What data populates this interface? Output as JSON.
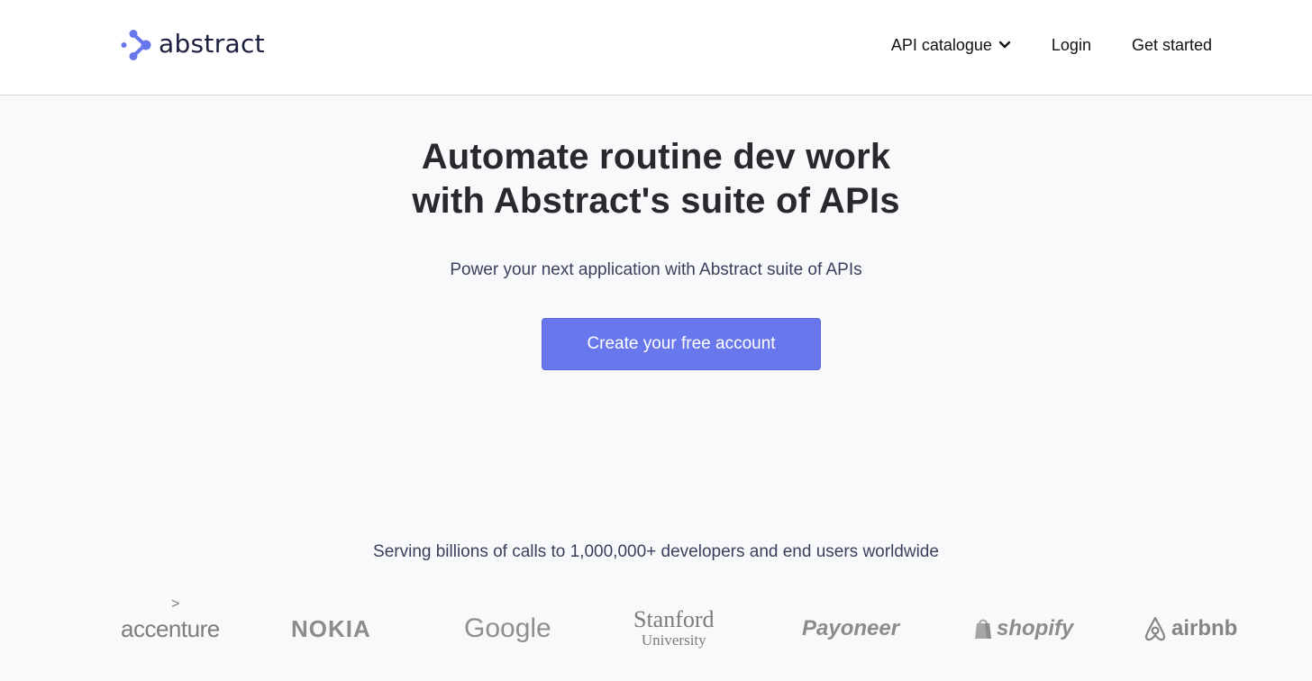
{
  "header": {
    "logo_text": "abstract",
    "nav": [
      {
        "label": "API catalogue",
        "has_dropdown": true
      },
      {
        "label": "Login"
      },
      {
        "label": "Get started"
      }
    ]
  },
  "hero": {
    "title_line1": "Automate routine dev work",
    "title_line2": "with Abstract's suite of APIs",
    "subtitle": "Power your next application with Abstract suite of APIs",
    "cta_label": "Create your free account"
  },
  "trust": {
    "text": "Serving billions of calls to 1,000,000+ developers and end users worldwide",
    "brands": [
      {
        "name": "accenture"
      },
      {
        "name": "NOKIA"
      },
      {
        "name": "Google"
      },
      {
        "name": "Stanford",
        "sub": "University"
      },
      {
        "name": "Payoneer"
      },
      {
        "name": "shopify"
      },
      {
        "name": "airbnb"
      }
    ]
  },
  "colors": {
    "accent": "#6877ec",
    "logo_mark": "#6877ec",
    "logo_text": "#1d1f3e",
    "page_bg": "#f8f9fb",
    "header_bg": "#ffffff",
    "brand_gray": "#8a8a8c"
  },
  "icons": {
    "logo": "abstract-logo-icon",
    "dropdown": "chevron-down-icon",
    "shopify": "shopify-bag-icon",
    "airbnb": "airbnb-belo-icon"
  }
}
